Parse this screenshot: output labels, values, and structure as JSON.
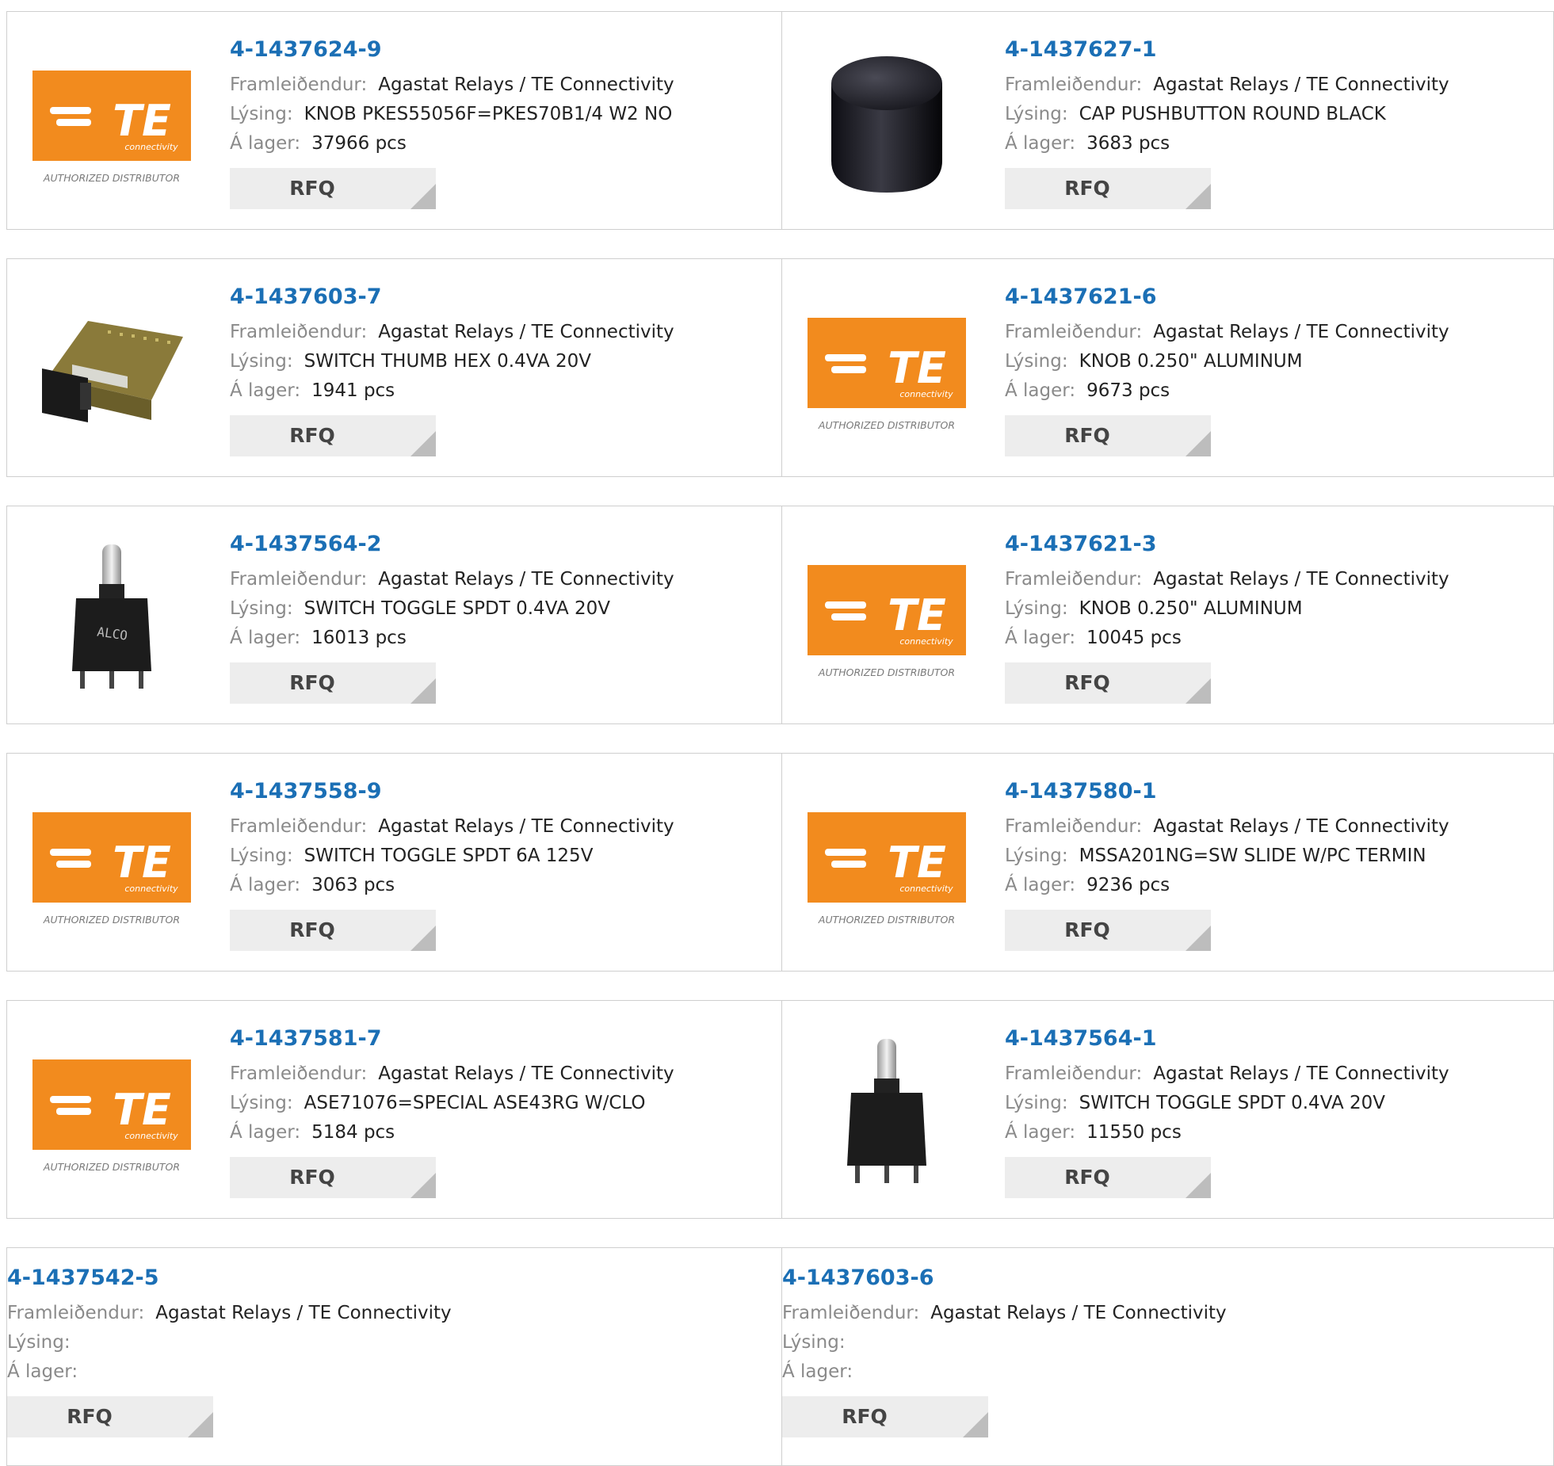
{
  "labels": {
    "manufacturer": "Framleiðendur:",
    "description": "Lýsing:",
    "stock": "Á lager:",
    "rfq": "RFQ"
  },
  "te_logo": {
    "wordmark": "TE",
    "sub": "connectivity",
    "tagline": "AUTHORIZED DISTRIBUTOR"
  },
  "colors": {
    "accent": "#1b6fb5",
    "te_orange": "#f28b1e",
    "button_bg": "#ededed"
  },
  "products": [
    {
      "part": "4-1437624-9",
      "manufacturer": "Agastat Relays / TE Connectivity",
      "description": "KNOB PKES55056F=PKES70B1/4 W2 NO",
      "stock": "37966 pcs",
      "image": "te-logo"
    },
    {
      "part": "4-1437627-1",
      "manufacturer": "Agastat Relays / TE Connectivity",
      "description": "CAP PUSHBUTTON ROUND BLACK",
      "stock": "3683 pcs",
      "image": "black-round-cap"
    },
    {
      "part": "4-1437603-7",
      "manufacturer": "Agastat Relays / TE Connectivity",
      "description": "SWITCH THUMB HEX 0.4VA 20V",
      "stock": "1941 pcs",
      "image": "thumbwheel-switch"
    },
    {
      "part": "4-1437621-6",
      "manufacturer": "Agastat Relays / TE Connectivity",
      "description": "KNOB 0.250\" ALUMINUM",
      "stock": "9673 pcs",
      "image": "te-logo"
    },
    {
      "part": "4-1437564-2",
      "manufacturer": "Agastat Relays / TE Connectivity",
      "description": "SWITCH TOGGLE SPDT 0.4VA 20V",
      "stock": "16013 pcs",
      "image": "toggle-switch-alco"
    },
    {
      "part": "4-1437621-3",
      "manufacturer": "Agastat Relays / TE Connectivity",
      "description": "KNOB 0.250\" ALUMINUM",
      "stock": "10045 pcs",
      "image": "te-logo"
    },
    {
      "part": "4-1437558-9",
      "manufacturer": "Agastat Relays / TE Connectivity",
      "description": "SWITCH TOGGLE SPDT 6A 125V",
      "stock": "3063 pcs",
      "image": "te-logo"
    },
    {
      "part": "4-1437580-1",
      "manufacturer": "Agastat Relays / TE Connectivity",
      "description": "MSSA201NG=SW SLIDE W/PC TERMIN",
      "stock": "9236 pcs",
      "image": "te-logo"
    },
    {
      "part": "4-1437581-7",
      "manufacturer": "Agastat Relays / TE Connectivity",
      "description": "ASE71076=SPECIAL ASE43RG W/CLO",
      "stock": "5184 pcs",
      "image": "te-logo"
    },
    {
      "part": "4-1437564-1",
      "manufacturer": "Agastat Relays / TE Connectivity",
      "description": "SWITCH TOGGLE SPDT 0.4VA 20V",
      "stock": "11550 pcs",
      "image": "toggle-switch"
    },
    {
      "part": "4-1437542-5",
      "manufacturer": "Agastat Relays / TE Connectivity",
      "description": "",
      "stock": "",
      "image": ""
    },
    {
      "part": "4-1437603-6",
      "manufacturer": "Agastat Relays / TE Connectivity",
      "description": "",
      "stock": "",
      "image": ""
    }
  ]
}
